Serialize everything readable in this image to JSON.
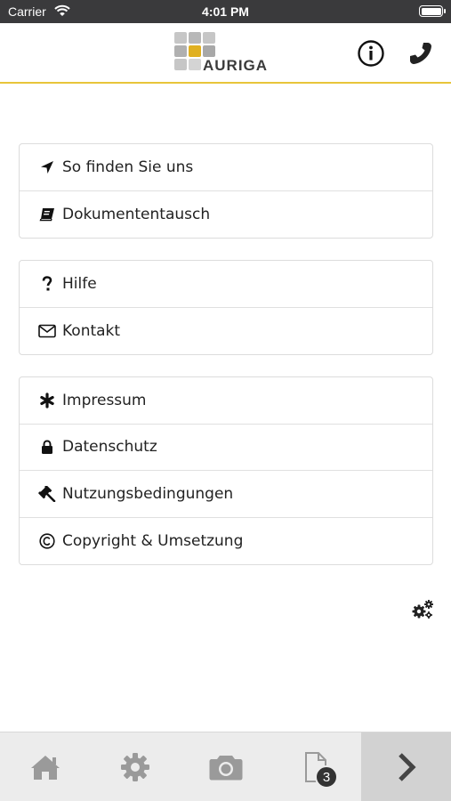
{
  "status_bar": {
    "carrier": "Carrier",
    "time": "4:01 PM"
  },
  "header": {
    "logo_text": "AURIGA",
    "info_icon": "info-icon",
    "phone_icon": "phone-icon"
  },
  "menu_groups": [
    {
      "items": [
        {
          "label": "So finden Sie uns",
          "icon": "location-arrow-icon"
        },
        {
          "label": "Dokumententausch",
          "icon": "book-icon"
        }
      ]
    },
    {
      "items": [
        {
          "label": "Hilfe",
          "icon": "question-icon"
        },
        {
          "label": "Kontakt",
          "icon": "envelope-icon"
        }
      ]
    },
    {
      "items": [
        {
          "label": "Impressum",
          "icon": "asterisk-icon"
        },
        {
          "label": "Datenschutz",
          "icon": "lock-icon"
        },
        {
          "label": "Nutzungsbedingungen",
          "icon": "gavel-icon"
        },
        {
          "label": "Copyright & Umsetzung",
          "icon": "copyright-icon"
        }
      ]
    }
  ],
  "settings_icon": "gears-icon",
  "tab_bar": {
    "tabs": [
      {
        "icon": "home-icon"
      },
      {
        "icon": "gear-icon"
      },
      {
        "icon": "camera-icon"
      },
      {
        "icon": "document-icon",
        "badge": "3"
      },
      {
        "icon": "chevron-right-icon"
      }
    ]
  },
  "colors": {
    "accent": "#e8c53a",
    "logo_highlight": "#e0b020",
    "icon_gray": "#9a9a9a",
    "status_bar": "#3a3a3c"
  }
}
